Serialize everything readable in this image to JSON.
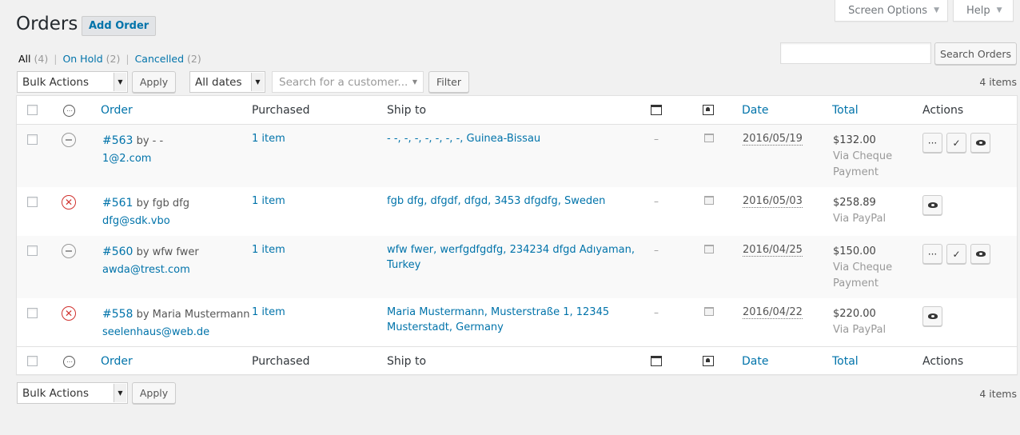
{
  "meta_tabs": {
    "screen_options": "Screen Options",
    "help": "Help",
    "caret": "▼"
  },
  "header": {
    "title": "Orders",
    "add_button": "Add Order"
  },
  "views": [
    {
      "label": "All",
      "count": "(4)"
    },
    {
      "label": "On Hold",
      "count": "(2)"
    },
    {
      "label": "Cancelled",
      "count": "(2)"
    }
  ],
  "views_sep": "|",
  "search": {
    "button": "Search Orders",
    "value": ""
  },
  "tablenav": {
    "bulk_actions": "Bulk Actions",
    "apply": "Apply",
    "dates": "All dates",
    "customer_placeholder": "Search for a customer...",
    "filter": "Filter",
    "items_count": "4 items"
  },
  "columns": {
    "status_icon": "⋯",
    "order": "Order",
    "purchased": "Purchased",
    "ship_to": "Ship to",
    "date": "Date",
    "total": "Total",
    "actions": "Actions"
  },
  "orders": [
    {
      "number": "#563",
      "by": "by - -",
      "email": "1@2.com",
      "status": "on-hold",
      "purchased": "1 item",
      "ship_to": "- -, -, -, -, -, -, -, Guinea-Bissau",
      "ship_to_2": "",
      "note": "–",
      "date": "2016/05/19",
      "total": "$132.00",
      "via": "Via Cheque",
      "via_2": "Payment",
      "actions": [
        "processing",
        "complete",
        "view"
      ]
    },
    {
      "number": "#561",
      "by": "by fgb dfg",
      "email": "dfg@sdk.vbo",
      "status": "cancelled",
      "purchased": "1 item",
      "ship_to": "fgb dfg, dfgdf, dfgd, 3453 dfgdfg, Sweden",
      "ship_to_2": "",
      "note": "–",
      "date": "2016/05/03",
      "total": "$258.89",
      "via": "Via PayPal",
      "via_2": "",
      "actions": [
        "view"
      ]
    },
    {
      "number": "#560",
      "by": "by wfw fwer",
      "email": "awda@trest.com",
      "status": "on-hold",
      "purchased": "1 item",
      "ship_to": "wfw fwer, werfgdfgdfg, 234234 dfgd Adıyaman,",
      "ship_to_2": "Turkey",
      "note": "–",
      "date": "2016/04/25",
      "total": "$150.00",
      "via": "Via Cheque",
      "via_2": "Payment",
      "actions": [
        "processing",
        "complete",
        "view"
      ]
    },
    {
      "number": "#558",
      "by": "by Maria Mustermann",
      "email": "seelenhaus@web.de",
      "status": "cancelled",
      "purchased": "1 item",
      "ship_to": "Maria Mustermann, Musterstraße 1, 12345",
      "ship_to_2": "Musterstadt, Germany",
      "note": "–",
      "date": "2016/04/22",
      "total": "$220.00",
      "via": "Via PayPal",
      "via_2": "",
      "actions": [
        "view"
      ]
    }
  ],
  "action_glyphs": {
    "processing": "···",
    "complete": "✓",
    "view": "view-icon"
  },
  "cancel_glyph": "✕",
  "colors": {
    "link": "#0073aa",
    "cancelled": "#d0312d",
    "background": "#f1f1f1"
  }
}
